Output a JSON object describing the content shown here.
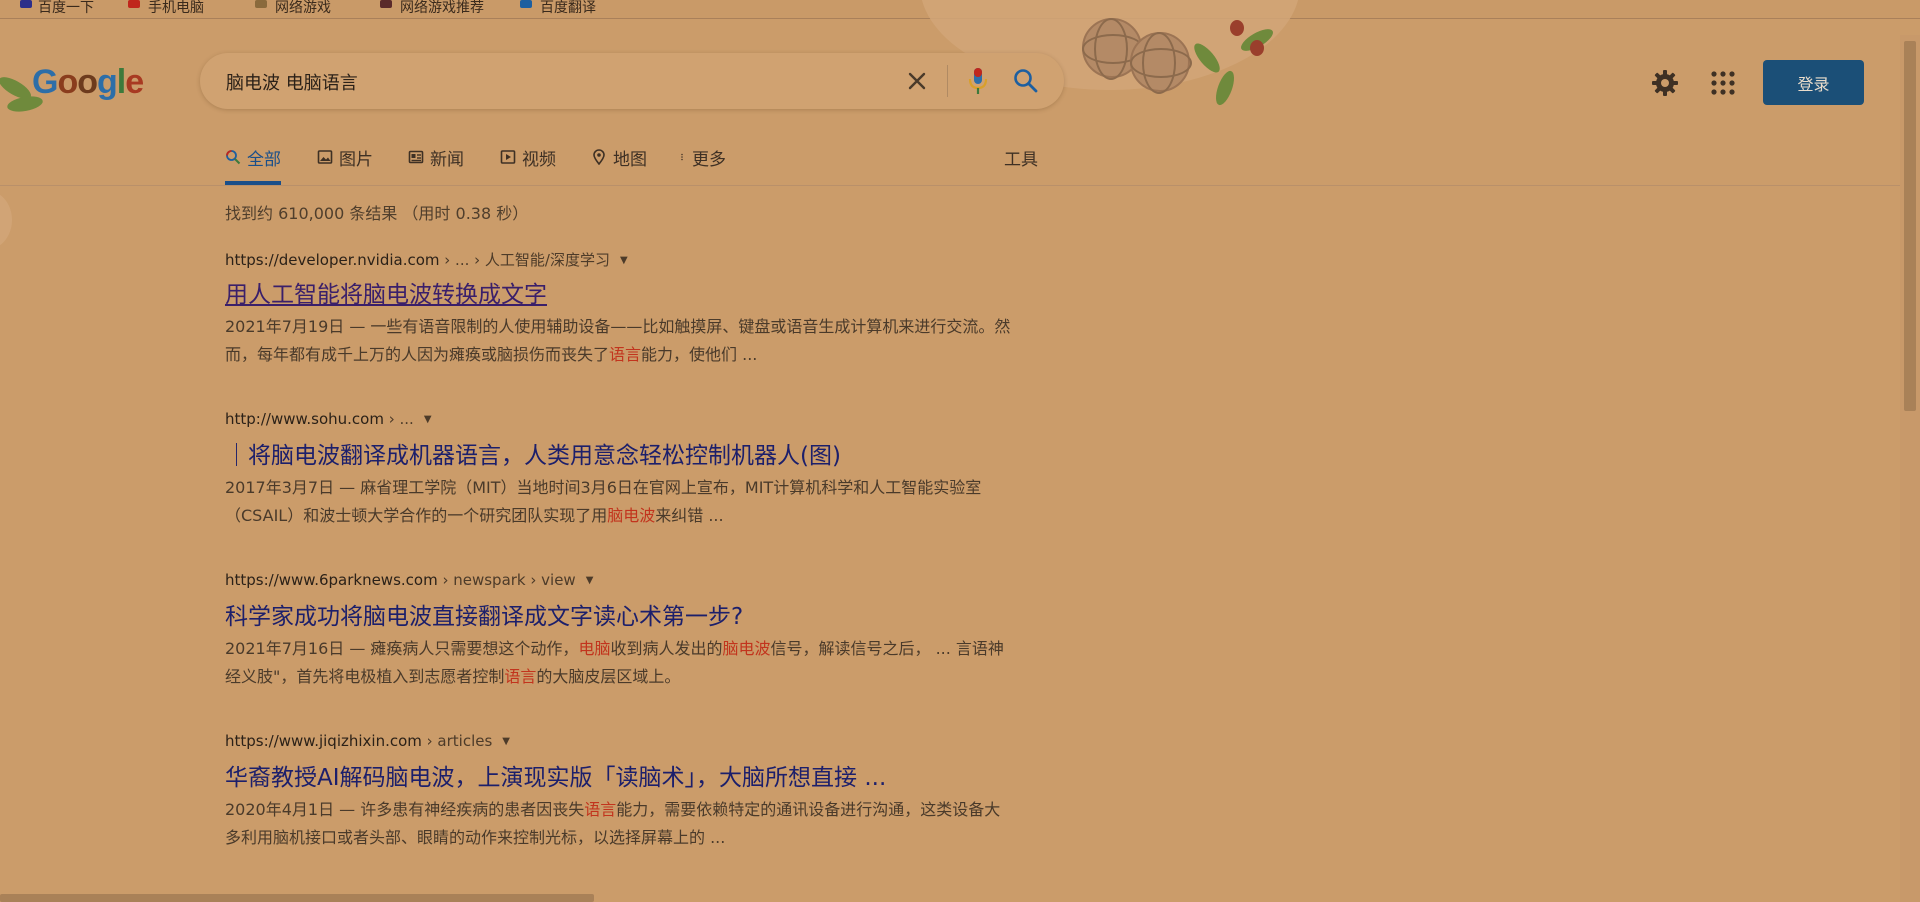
{
  "bookmarks": [
    {
      "label": "百度一下",
      "icon_color": "#2d2f8a"
    },
    {
      "label": "手机电脑",
      "icon_color": "#c0261c"
    },
    {
      "label": "网络游戏",
      "icon_color": "#8a6a3c"
    },
    {
      "label": "网络游戏推荐",
      "icon_color": "#5a2a2a"
    },
    {
      "label": "百度翻译",
      "icon_color": "#1d5fa0"
    }
  ],
  "logo": {
    "text": "Google",
    "letters": [
      "G",
      "o",
      "o",
      "g",
      "l",
      "e"
    ],
    "colors": [
      "#2d6ea8",
      "#8a3d1d",
      "#6d3b1d",
      "#2d6ea8",
      "#3d7a3b",
      "#a83a22"
    ]
  },
  "search": {
    "query": "脑电波 电脑语言",
    "clear_icon": "close-icon",
    "mic_icon": "mic-icon",
    "search_icon": "search-icon"
  },
  "header": {
    "settings_icon": "gear-icon",
    "apps_icon": "apps-grid-icon",
    "signin_label": "登录",
    "signin_color": "#1b4f77"
  },
  "tabs": [
    {
      "label": "全部",
      "icon": "search-icon",
      "active": true
    },
    {
      "label": "图片",
      "icon": "image-icon",
      "active": false
    },
    {
      "label": "新闻",
      "icon": "news-icon",
      "active": false
    },
    {
      "label": "视频",
      "icon": "video-icon",
      "active": false
    },
    {
      "label": "地图",
      "icon": "map-pin-icon",
      "active": false
    },
    {
      "label": "更多",
      "icon": "more-vert-icon",
      "active": false
    },
    {
      "label": "工具",
      "icon": "",
      "active": false
    }
  ],
  "stats": "找到约 610,000 条结果 （用时 0.38 秒）",
  "results": [
    {
      "domain": "https://developer.nvidia.com",
      "path": " › ... › 人工智能/深度学习",
      "title": "用人工智能将脑电波转换成文字",
      "visited": true,
      "snippet": [
        {
          "t": "2021年7月19日 — 一些有语音限制的人使用辅助设备——比如触摸屏、键盘或语音生成计算机来进行交流。然而，每年都有成千上万的人因为瘫痪或脑损伤而丧失了",
          "hl": false
        },
        {
          "t": "语言",
          "hl": true
        },
        {
          "t": "能力，使他们 ...",
          "hl": false
        }
      ]
    },
    {
      "domain": "http://www.sohu.com",
      "path": " › ...",
      "title": "｜将脑电波翻译成机器语言，人类用意念轻松控制机器人(图)",
      "visited": false,
      "snippet": [
        {
          "t": "2017年3月7日 — 麻省理工学院（MIT）当地时间3月6日在官网上宣布，MIT计算机科学和人工智能实验室（CSAIL）和波士顿大学合作的一个研究团队实现了用",
          "hl": false
        },
        {
          "t": "脑电波",
          "hl": true
        },
        {
          "t": "来纠错 ...",
          "hl": false
        }
      ]
    },
    {
      "domain": "https://www.6parknews.com",
      "path": " › newspark › view",
      "title": "科学家成功将脑电波直接翻译成文字读心术第一步?",
      "visited": false,
      "snippet": [
        {
          "t": "2021年7月16日 — 瘫痪病人只需要想这个动作，",
          "hl": false
        },
        {
          "t": "电脑",
          "hl": true
        },
        {
          "t": "收到病人发出的",
          "hl": false
        },
        {
          "t": "脑电波",
          "hl": true
        },
        {
          "t": "信号，解读信号之后， ... 言语神经义肢\"，首先将电极植入到志愿者控制",
          "hl": false
        },
        {
          "t": "语言",
          "hl": true
        },
        {
          "t": "的大脑皮层区域上。",
          "hl": false
        }
      ]
    },
    {
      "domain": "https://www.jiqizhixin.com",
      "path": " › articles",
      "title": "华裔教授AI解码脑电波，上演现实版「读脑术」，大脑所想直接 ...",
      "visited": false,
      "snippet": [
        {
          "t": "2020年4月1日 — 许多患有神经疾病的患者因丧失",
          "hl": false
        },
        {
          "t": "语言",
          "hl": true
        },
        {
          "t": "能力，需要依赖特定的通讯设备进行沟通，这类设备大多利用脑机接口或者头部、眼睛的动作来控制光标，以选择屏幕上的 ...",
          "hl": false
        }
      ]
    }
  ],
  "colors": {
    "page_bg": "#cb9c6a",
    "link": "#1c1f6b",
    "highlight": "#c2341d",
    "active_tab": "#1a4f8a"
  }
}
